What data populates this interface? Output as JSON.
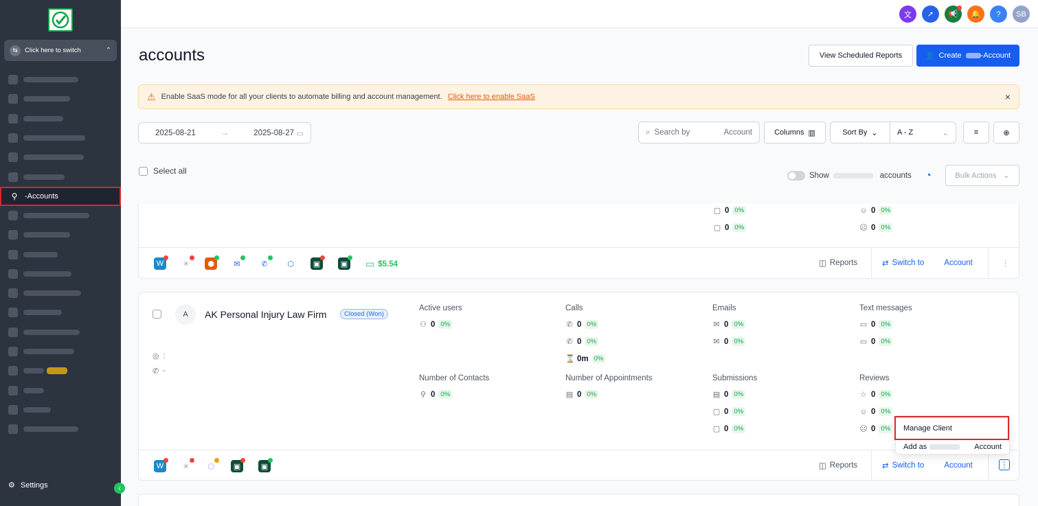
{
  "sidebar": {
    "switcher_label": "Click here to switch",
    "active_item": "-Accounts",
    "settings_label": "Settings",
    "collapse_glyph": "‹",
    "items_blurred_widths": [
      80,
      68,
      58,
      90,
      88,
      60,
      0,
      96,
      68,
      50,
      70,
      84,
      56,
      82,
      74,
      30,
      30,
      0,
      80
    ]
  },
  "topbar": {
    "avatar_initials": "SB",
    "icons": [
      {
        "name": "translate-icon",
        "color": "#7c3aed",
        "glyph": "文"
      },
      {
        "name": "rocket-icon",
        "color": "#2563eb",
        "glyph": "➚"
      },
      {
        "name": "megaphone-icon",
        "color": "#15803d",
        "glyph": "📢"
      },
      {
        "name": "bell-icon",
        "color": "#f97316",
        "glyph": "🔔"
      },
      {
        "name": "help-icon",
        "color": "#3b82f6",
        "glyph": "?"
      }
    ],
    "avatar_color": "#94a3c8"
  },
  "header": {
    "title": "accounts",
    "view_reports_label": "View Scheduled Reports",
    "create_prefix": "Create",
    "create_suffix": "-Account"
  },
  "alert": {
    "text": "Enable SaaS mode for all your clients to automate billing and account management.",
    "link": "Click here to enable SaaS",
    "close": "×"
  },
  "filters": {
    "date_from": "2025-08-21",
    "date_to": "2025-08-27",
    "arrow": "→",
    "search_placeholder": "Search by",
    "search_suffix": "Account",
    "columns_label": "Columns",
    "sort_label": "Sort By",
    "sort_value": "A - Z",
    "select_all": "Select all",
    "show_label": "Show",
    "accounts_label": "accounts",
    "bulk_actions": "Bulk Actions"
  },
  "card1": {
    "stats": [
      {
        "v": "0",
        "p": "0%"
      },
      {
        "v": "0",
        "p": "0%"
      },
      {
        "v": "0",
        "p": "0%"
      },
      {
        "v": "0",
        "p": "0%"
      }
    ],
    "wallet": "$5.54",
    "reports": "Reports",
    "switch_to": "Switch to",
    "account": "Account"
  },
  "card2": {
    "avatar_letter": "A",
    "name": "AK Personal Injury Law Firm",
    "status": "Closed (Won)",
    "location_sep": ":",
    "phone_sep": "-",
    "labels": {
      "active_users": "Active users",
      "calls": "Calls",
      "emails": "Emails",
      "text_messages": "Text messages",
      "contacts": "Number of Contacts",
      "appointments": "Number of Appointments",
      "submissions": "Submissions",
      "reviews": "Reviews"
    },
    "values": {
      "active_users": {
        "v": "0",
        "p": "0%"
      },
      "calls_in": {
        "v": "0",
        "p": "0%"
      },
      "calls_out": {
        "v": "0",
        "p": "0%"
      },
      "call_time": {
        "v": "0m",
        "p": "0%"
      },
      "emails_in": {
        "v": "0",
        "p": "0%"
      },
      "emails_out": {
        "v": "0",
        "p": "0%"
      },
      "sms_in": {
        "v": "0",
        "p": "0%"
      },
      "sms_out": {
        "v": "0",
        "p": "0%"
      },
      "contacts": {
        "v": "0",
        "p": "0%"
      },
      "appointments": {
        "v": "0",
        "p": "0%"
      },
      "sub_forms": {
        "v": "0",
        "p": "0%"
      },
      "sub_surveys": {
        "v": "0",
        "p": "0%"
      },
      "sub_quiz": {
        "v": "0",
        "p": "0%"
      },
      "reviews_total": {
        "v": "0",
        "p": "0%"
      },
      "reviews_pos": {
        "v": "0",
        "p": "0%"
      },
      "reviews_neg": {
        "v": "0",
        "p": "0%"
      }
    },
    "reports": "Reports",
    "switch_to": "Switch to",
    "account": "Account"
  },
  "menu": {
    "manage_client": "Manage Client",
    "add_as": "Add as",
    "account": "Account"
  }
}
